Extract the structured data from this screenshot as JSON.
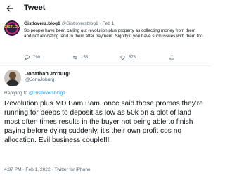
{
  "header": {
    "title": "Tweet"
  },
  "quoted_tweet": {
    "avatar_text": "GISTLOVER",
    "display_name": "Gistlovers.blog1",
    "handle": "@Gistloversblog1",
    "separator": "·",
    "date": "Feb 1",
    "text": "So people have been calling out revolution plus property as collecting money from them and not allocating land to them after payment. Signify if you have such issues with them too",
    "replies": "790",
    "retweets": "155",
    "likes": "573"
  },
  "tweet": {
    "display_name": "Jonathan Jo'burg!",
    "handle": "@JonaJoburg",
    "replying_prefix": "Replying to ",
    "replying_to": "@Gistloversblog1",
    "text": "Revolution plus MD Bam Bam, once said those promos they're running for peeps to deposit as low as 50k on a plot of land most often times results in the buyer not being able to finish paying before dying suddenly, it's their own profit cos no allocation. Evil business couple!!!",
    "timestamp": "4:37 PM · Feb 1, 2022 · Twitter for iPhone"
  },
  "colors": {
    "link": "#1d9bf0",
    "secondary": "#536471",
    "text": "#0f1419"
  },
  "icons": [
    "back-arrow-icon",
    "reply-icon",
    "retweet-icon",
    "like-icon",
    "share-icon"
  ]
}
